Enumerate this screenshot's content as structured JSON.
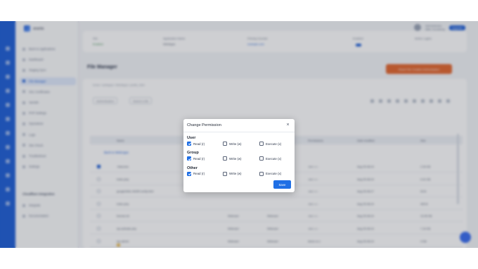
{
  "background_app": {
    "brand": "ananta",
    "user": {
      "role": "Administrator",
      "name": "Mike Goodwing"
    },
    "upgrade_label": "Upgrade",
    "sidebar_items": [
      {
        "label": "Back to Applications",
        "active": false
      },
      {
        "label": "Dashboard",
        "active": false
      },
      {
        "label": "Staging Sync",
        "active": false
      },
      {
        "label": "File Manager",
        "active": true
      },
      {
        "label": "SSL Certificates",
        "active": false
      },
      {
        "label": "Varnish",
        "active": false
      },
      {
        "label": "PHP Settings",
        "active": false
      },
      {
        "label": "Operations",
        "active": false
      },
      {
        "label": "Logs",
        "active": false
      },
      {
        "label": "Site Check",
        "active": false
      },
      {
        "label": "Troubleshoot",
        "active": false
      },
      {
        "label": "Settings",
        "active": false
      }
    ],
    "sidebar_section": "Cloudflare Integration",
    "sidebar_section_items": [
      {
        "label": "Integrate"
      },
      {
        "label": "Documentation"
      }
    ],
    "info": [
      {
        "label": "SSL",
        "value": "Enabled"
      },
      {
        "label": "Application Name",
        "value": "WebApps"
      },
      {
        "label": "Primary Domain",
        "value": "example.com"
      },
      {
        "label": "Enabled",
        "value": ""
      },
      {
        "label": "Active Logins",
        "value": ""
      }
    ],
    "page_title": "File Manager",
    "action_button": "Reset File Creation Authorisation",
    "breadcrumb": "home / webapps / WebApps / public_html",
    "filter_label": "Authentication",
    "search_placeholder": "Search a file",
    "table_headers": [
      "Name",
      "Owner",
      "Group",
      "Permissions",
      "Date modified",
      "Size"
    ],
    "back_link": "Back to WebApps",
    "rows": [
      {
        "name": ".htaccess",
        "owner": "",
        "group": "",
        "perm": "-rw-r--r--",
        "date": "Aug 25 08:24",
        "size": "2.34 KB",
        "folder": false,
        "checked": true
      },
      {
        "name": "index.php",
        "owner": "",
        "group": "",
        "perm": "-rw-r--r--",
        "date": "Aug 25 08:24",
        "size": "0.41 KB",
        "folder": false,
        "checked": false
      },
      {
        "name": "google3b5c-4b0f2f-verify.html",
        "owner": "",
        "group": "",
        "perm": "-rw-r--r--",
        "date": "Aug 25 08:27",
        "size": "53 B",
        "folder": false,
        "checked": false
      },
      {
        "name": "index.php",
        "owner": "",
        "group": "",
        "perm": "-rw-r--r--",
        "date": "Aug 25 08:24",
        "size": "405 B",
        "folder": false,
        "checked": false
      },
      {
        "name": "license.txt",
        "owner": "Webuser",
        "group": "Webuser",
        "perm": "-rw-r--r--",
        "date": "Aug 25 08:24",
        "size": "19.45 KB",
        "folder": false,
        "checked": false
      },
      {
        "name": "wp-activate.php",
        "owner": "Webuser",
        "group": "Webuser",
        "perm": "-rw-r--r--",
        "date": "Aug 25 08:24",
        "size": "7.19 KB",
        "folder": false,
        "checked": false
      },
      {
        "name": "wp-admin",
        "owner": "Webuser",
        "group": "Webuser",
        "perm": "drwxr-xr-x",
        "date": "Aug 25 08:24",
        "size": "4 KB",
        "folder": true,
        "checked": false
      },
      {
        "name": "wp-blog-header.php",
        "owner": "Webuser",
        "group": "Webuser",
        "perm": "-rw-r--r--",
        "date": "Aug 25 08:24",
        "size": "351 B",
        "folder": false,
        "checked": false
      },
      {
        "name": "wp-comments-post.php",
        "owner": "Webuser",
        "group": "Webuser",
        "perm": "-rw-r--r--",
        "date": "Aug 25 08:24",
        "size": "2.27 KB",
        "folder": false,
        "checked": false
      }
    ]
  },
  "modal": {
    "title": "Change Permission",
    "close_label": "×",
    "groups": [
      {
        "label": "User",
        "perms": [
          {
            "label": "Read (r)",
            "checked": true
          },
          {
            "label": "Write (w)",
            "checked": false
          },
          {
            "label": "Execute (x)",
            "checked": false
          }
        ]
      },
      {
        "label": "Group",
        "perms": [
          {
            "label": "Read (r)",
            "checked": true
          },
          {
            "label": "Write (w)",
            "checked": false
          },
          {
            "label": "Execute (x)",
            "checked": false
          }
        ]
      },
      {
        "label": "Other",
        "perms": [
          {
            "label": "Read (r)",
            "checked": true
          },
          {
            "label": "Write (w)",
            "checked": false
          },
          {
            "label": "Execute (x)",
            "checked": false
          }
        ]
      }
    ],
    "save_label": "Save"
  },
  "colors": {
    "accent": "#1f6fe5",
    "orange": "#e3672f",
    "sidebar_rail": "#1f5fd6"
  }
}
